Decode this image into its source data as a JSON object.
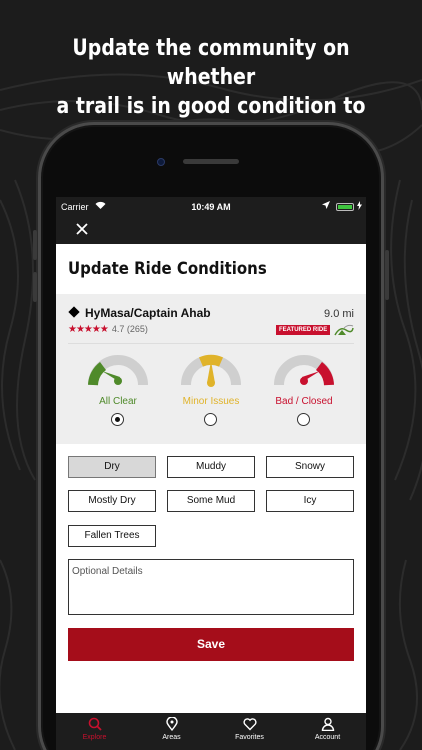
{
  "headline": {
    "line1": "Update the community on whether",
    "line2": "a trail is in good condition to ride."
  },
  "status_bar": {
    "carrier": "Carrier",
    "time": "10:49 AM"
  },
  "page_title": "Update Ride Conditions",
  "trail": {
    "name": "HyMasa/Captain Ahab",
    "distance": "9.0 mi",
    "rating_value": "4.7",
    "rating_count": "(265)",
    "stars": 4.7,
    "featured_label": "FEATURED RIDE"
  },
  "conditions": [
    {
      "label": "All Clear",
      "color": "#4f8a2a",
      "checked": true
    },
    {
      "label": "Minor Issues",
      "color": "#e0b32a",
      "checked": false
    },
    {
      "label": "Bad / Closed",
      "color": "#c8102e",
      "checked": false
    }
  ],
  "chips": [
    {
      "label": "Dry",
      "selected": true
    },
    {
      "label": "Muddy",
      "selected": false
    },
    {
      "label": "Snowy",
      "selected": false
    },
    {
      "label": "Mostly Dry",
      "selected": false
    },
    {
      "label": "Some Mud",
      "selected": false
    },
    {
      "label": "Icy",
      "selected": false
    },
    {
      "label": "Fallen Trees",
      "selected": false
    }
  ],
  "details_placeholder": "Optional Details",
  "save_label": "Save",
  "tabs": [
    {
      "label": "Explore",
      "icon": "search-icon",
      "active": true
    },
    {
      "label": "Areas",
      "icon": "map-pin-icon",
      "active": false
    },
    {
      "label": "Favorites",
      "icon": "heart-icon",
      "active": false
    },
    {
      "label": "Account",
      "icon": "user-icon",
      "active": false
    }
  ],
  "colors": {
    "brand_red": "#c8102e",
    "save_red": "#a50d1a",
    "dark_bar": "#1d1d1d"
  }
}
